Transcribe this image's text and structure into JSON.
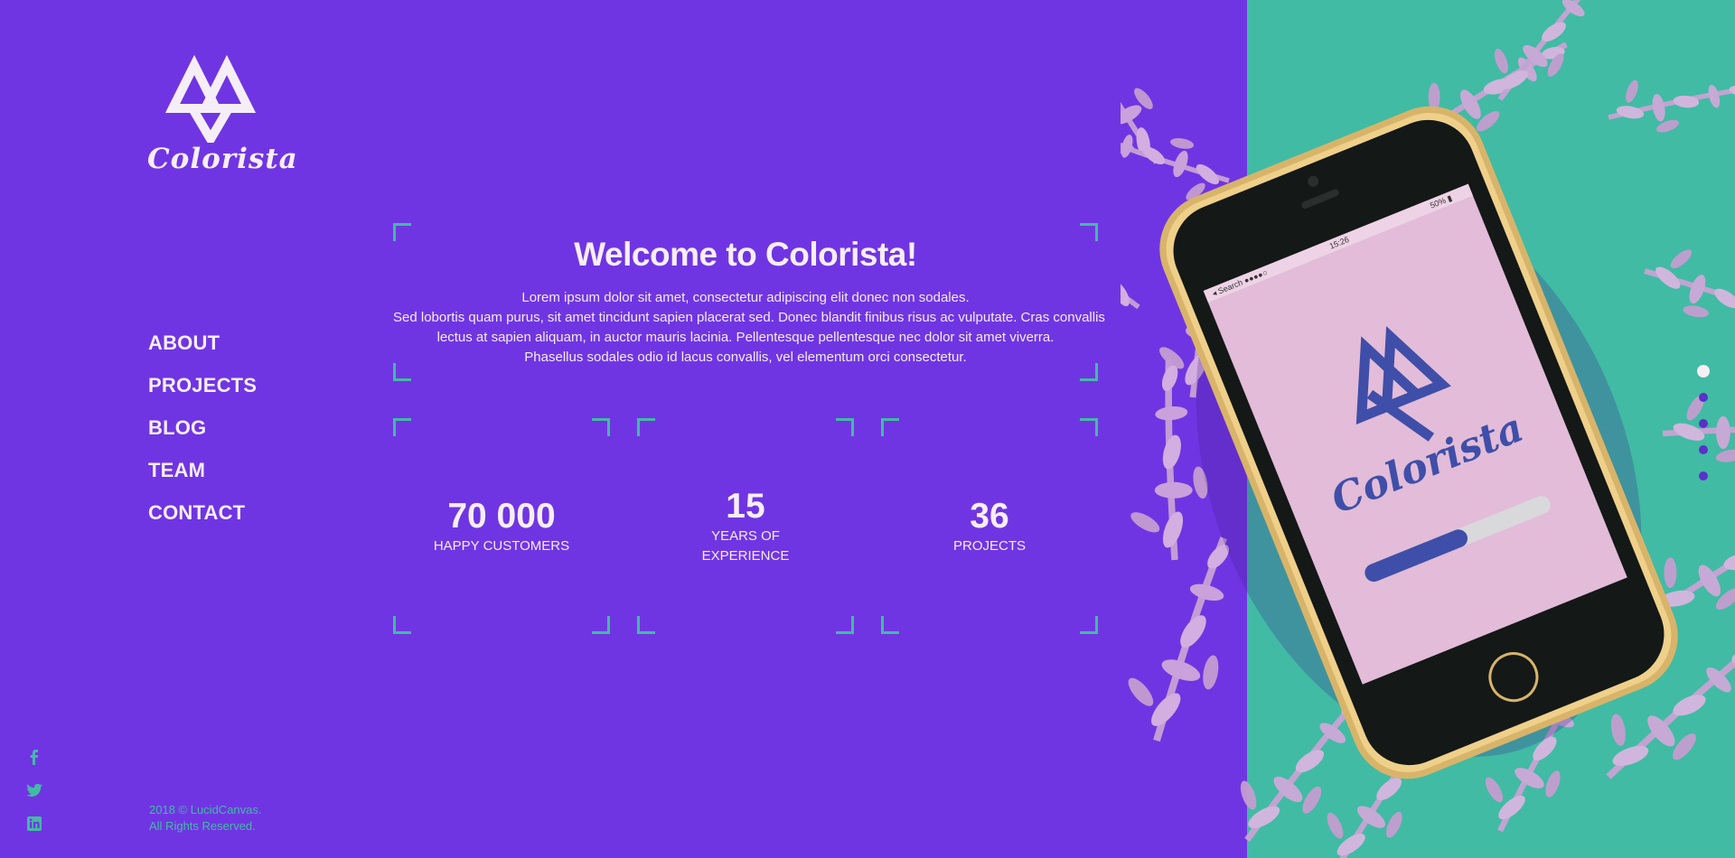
{
  "brand": {
    "name": "Colorista"
  },
  "nav": {
    "items": [
      {
        "label": "ABOUT"
      },
      {
        "label": "PROJECTS"
      },
      {
        "label": "BLOG"
      },
      {
        "label": "TEAM"
      },
      {
        "label": "CONTACT"
      }
    ]
  },
  "hero": {
    "title": "Welcome to Colorista!",
    "lines": [
      "Lorem ipsum dolor sit amet, consectetur adipiscing elit donec non sodales.",
      "Sed lobortis quam purus, sit amet tincidunt sapien placerat sed. Donec blandit finibus risus ac vulputate. Cras convallis",
      "lectus at sapien aliquam, in auctor mauris lacinia. Pellentesque pellentesque nec dolor sit amet viverra.",
      "Phasellus sodales odio id lacus convallis, vel elementum orci consectetur."
    ]
  },
  "stats": [
    {
      "value": "70 000",
      "label_line1": "HAPPY CUSTOMERS",
      "label_line2": ""
    },
    {
      "value": "15",
      "label_line1": "YEARS OF",
      "label_line2": "EXPERIENCE"
    },
    {
      "value": "36",
      "label_line1": "PROJECTS",
      "label_line2": ""
    }
  ],
  "socials": [
    {
      "icon": "facebook-icon"
    },
    {
      "icon": "twitter-icon"
    },
    {
      "icon": "linkedin-icon"
    }
  ],
  "footer": {
    "copyright_line1": "2018 © LucidCanvas.",
    "copyright_line2": "All Rights Reserved."
  },
  "phone": {
    "status_carrier": "Search",
    "status_time": "15:26",
    "status_battery": "50%",
    "app_name": "Colorista",
    "loading_progress": 0.55
  },
  "slider": {
    "count": 5,
    "active_index": 0
  },
  "colors": {
    "primary": "#7035e2",
    "accent": "#41bba4",
    "text": "#f6eef6",
    "phone_screen": "#e2bcd8",
    "phone_brand": "#3f4ea8"
  }
}
